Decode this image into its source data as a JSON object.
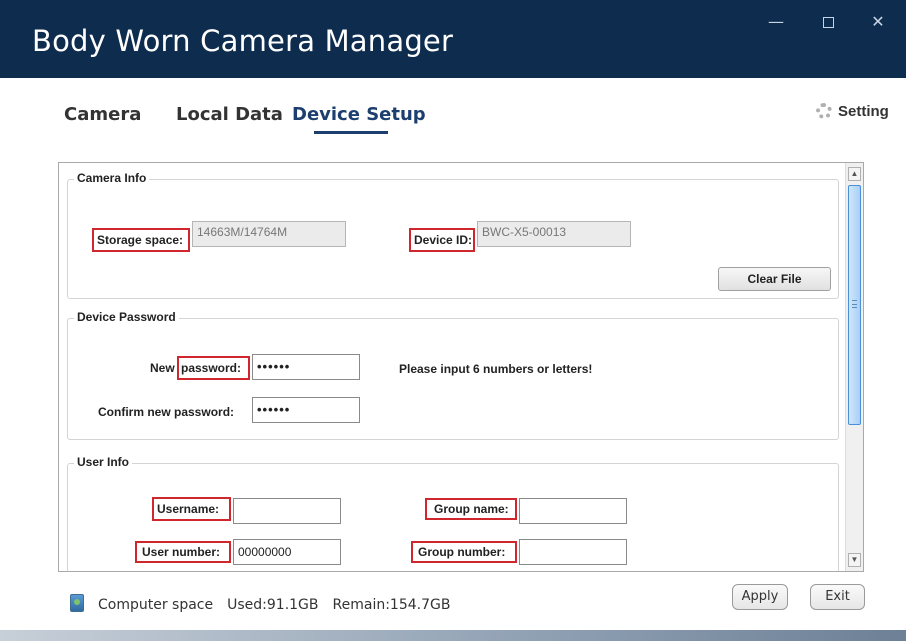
{
  "window": {
    "title": "Body Worn Camera Manager",
    "controls": {
      "minimize": "—",
      "maximize": "",
      "close": "✕"
    }
  },
  "nav": {
    "tabs": [
      {
        "label": "Camera"
      },
      {
        "label": "Local Data"
      },
      {
        "label": "Device Setup",
        "active": true
      }
    ],
    "setting_label": "Setting",
    "setting_icon": "gear-icon"
  },
  "camera_info": {
    "title": "Camera Info",
    "storage_label": "Storage space:",
    "storage_value": "14663M/14764M",
    "device_id_label": "Device ID:",
    "device_id_value": "BWC-X5-00013",
    "clear_button": "Clear File"
  },
  "device_password": {
    "title": "Device Password",
    "new_label_prefix": "New",
    "new_label_highlight": "password:",
    "new_value": "••••••",
    "hint": "Please input 6 numbers or letters!",
    "confirm_label": "Confirm new password:",
    "confirm_value": "••••••"
  },
  "user_info": {
    "title": "User Info",
    "username_label": "Username:",
    "username_value": "",
    "group_name_label": "Group name:",
    "group_name_value": "",
    "user_number_label": "User number:",
    "user_number_value": "00000000",
    "group_number_label": "Group number:",
    "group_number_value": ""
  },
  "footer": {
    "computer_space_label": "Computer space",
    "used": "Used:91.1GB",
    "remain": "Remain:154.7GB",
    "apply_button": "Apply",
    "exit_button": "Exit"
  },
  "colors": {
    "titlebar": "#0e2c4e",
    "active_tab": "#1d3f70",
    "highlight_box": "#d0262e",
    "scroll_thumb": "#a8d0f5"
  }
}
